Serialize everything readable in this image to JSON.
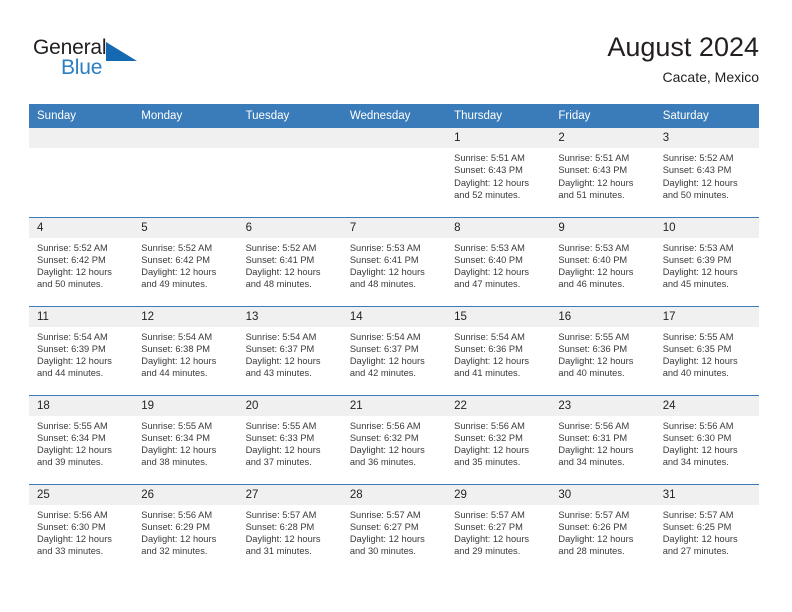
{
  "brand": {
    "name_top": "General",
    "name_bottom": "Blue",
    "flag_icon": "triangle-flag-icon",
    "accent_color": "#2b7fc3",
    "flag_color": "#1569b0"
  },
  "header": {
    "title": "August 2024",
    "subtitle": "Cacate, Mexico"
  },
  "calendar": {
    "header_bg": "#3a7cba",
    "daynum_bg": "#f0f0f0",
    "weekdays": [
      "Sunday",
      "Monday",
      "Tuesday",
      "Wednesday",
      "Thursday",
      "Friday",
      "Saturday"
    ],
    "weeks": [
      [
        {
          "day": "",
          "sunrise": "",
          "sunset": "",
          "daylight_line1": "",
          "daylight_line2": ""
        },
        {
          "day": "",
          "sunrise": "",
          "sunset": "",
          "daylight_line1": "",
          "daylight_line2": ""
        },
        {
          "day": "",
          "sunrise": "",
          "sunset": "",
          "daylight_line1": "",
          "daylight_line2": ""
        },
        {
          "day": "",
          "sunrise": "",
          "sunset": "",
          "daylight_line1": "",
          "daylight_line2": ""
        },
        {
          "day": "1",
          "sunrise": "Sunrise: 5:51 AM",
          "sunset": "Sunset: 6:43 PM",
          "daylight_line1": "Daylight: 12 hours",
          "daylight_line2": "and 52 minutes."
        },
        {
          "day": "2",
          "sunrise": "Sunrise: 5:51 AM",
          "sunset": "Sunset: 6:43 PM",
          "daylight_line1": "Daylight: 12 hours",
          "daylight_line2": "and 51 minutes."
        },
        {
          "day": "3",
          "sunrise": "Sunrise: 5:52 AM",
          "sunset": "Sunset: 6:43 PM",
          "daylight_line1": "Daylight: 12 hours",
          "daylight_line2": "and 50 minutes."
        }
      ],
      [
        {
          "day": "4",
          "sunrise": "Sunrise: 5:52 AM",
          "sunset": "Sunset: 6:42 PM",
          "daylight_line1": "Daylight: 12 hours",
          "daylight_line2": "and 50 minutes."
        },
        {
          "day": "5",
          "sunrise": "Sunrise: 5:52 AM",
          "sunset": "Sunset: 6:42 PM",
          "daylight_line1": "Daylight: 12 hours",
          "daylight_line2": "and 49 minutes."
        },
        {
          "day": "6",
          "sunrise": "Sunrise: 5:52 AM",
          "sunset": "Sunset: 6:41 PM",
          "daylight_line1": "Daylight: 12 hours",
          "daylight_line2": "and 48 minutes."
        },
        {
          "day": "7",
          "sunrise": "Sunrise: 5:53 AM",
          "sunset": "Sunset: 6:41 PM",
          "daylight_line1": "Daylight: 12 hours",
          "daylight_line2": "and 48 minutes."
        },
        {
          "day": "8",
          "sunrise": "Sunrise: 5:53 AM",
          "sunset": "Sunset: 6:40 PM",
          "daylight_line1": "Daylight: 12 hours",
          "daylight_line2": "and 47 minutes."
        },
        {
          "day": "9",
          "sunrise": "Sunrise: 5:53 AM",
          "sunset": "Sunset: 6:40 PM",
          "daylight_line1": "Daylight: 12 hours",
          "daylight_line2": "and 46 minutes."
        },
        {
          "day": "10",
          "sunrise": "Sunrise: 5:53 AM",
          "sunset": "Sunset: 6:39 PM",
          "daylight_line1": "Daylight: 12 hours",
          "daylight_line2": "and 45 minutes."
        }
      ],
      [
        {
          "day": "11",
          "sunrise": "Sunrise: 5:54 AM",
          "sunset": "Sunset: 6:39 PM",
          "daylight_line1": "Daylight: 12 hours",
          "daylight_line2": "and 44 minutes."
        },
        {
          "day": "12",
          "sunrise": "Sunrise: 5:54 AM",
          "sunset": "Sunset: 6:38 PM",
          "daylight_line1": "Daylight: 12 hours",
          "daylight_line2": "and 44 minutes."
        },
        {
          "day": "13",
          "sunrise": "Sunrise: 5:54 AM",
          "sunset": "Sunset: 6:37 PM",
          "daylight_line1": "Daylight: 12 hours",
          "daylight_line2": "and 43 minutes."
        },
        {
          "day": "14",
          "sunrise": "Sunrise: 5:54 AM",
          "sunset": "Sunset: 6:37 PM",
          "daylight_line1": "Daylight: 12 hours",
          "daylight_line2": "and 42 minutes."
        },
        {
          "day": "15",
          "sunrise": "Sunrise: 5:54 AM",
          "sunset": "Sunset: 6:36 PM",
          "daylight_line1": "Daylight: 12 hours",
          "daylight_line2": "and 41 minutes."
        },
        {
          "day": "16",
          "sunrise": "Sunrise: 5:55 AM",
          "sunset": "Sunset: 6:36 PM",
          "daylight_line1": "Daylight: 12 hours",
          "daylight_line2": "and 40 minutes."
        },
        {
          "day": "17",
          "sunrise": "Sunrise: 5:55 AM",
          "sunset": "Sunset: 6:35 PM",
          "daylight_line1": "Daylight: 12 hours",
          "daylight_line2": "and 40 minutes."
        }
      ],
      [
        {
          "day": "18",
          "sunrise": "Sunrise: 5:55 AM",
          "sunset": "Sunset: 6:34 PM",
          "daylight_line1": "Daylight: 12 hours",
          "daylight_line2": "and 39 minutes."
        },
        {
          "day": "19",
          "sunrise": "Sunrise: 5:55 AM",
          "sunset": "Sunset: 6:34 PM",
          "daylight_line1": "Daylight: 12 hours",
          "daylight_line2": "and 38 minutes."
        },
        {
          "day": "20",
          "sunrise": "Sunrise: 5:55 AM",
          "sunset": "Sunset: 6:33 PM",
          "daylight_line1": "Daylight: 12 hours",
          "daylight_line2": "and 37 minutes."
        },
        {
          "day": "21",
          "sunrise": "Sunrise: 5:56 AM",
          "sunset": "Sunset: 6:32 PM",
          "daylight_line1": "Daylight: 12 hours",
          "daylight_line2": "and 36 minutes."
        },
        {
          "day": "22",
          "sunrise": "Sunrise: 5:56 AM",
          "sunset": "Sunset: 6:32 PM",
          "daylight_line1": "Daylight: 12 hours",
          "daylight_line2": "and 35 minutes."
        },
        {
          "day": "23",
          "sunrise": "Sunrise: 5:56 AM",
          "sunset": "Sunset: 6:31 PM",
          "daylight_line1": "Daylight: 12 hours",
          "daylight_line2": "and 34 minutes."
        },
        {
          "day": "24",
          "sunrise": "Sunrise: 5:56 AM",
          "sunset": "Sunset: 6:30 PM",
          "daylight_line1": "Daylight: 12 hours",
          "daylight_line2": "and 34 minutes."
        }
      ],
      [
        {
          "day": "25",
          "sunrise": "Sunrise: 5:56 AM",
          "sunset": "Sunset: 6:30 PM",
          "daylight_line1": "Daylight: 12 hours",
          "daylight_line2": "and 33 minutes."
        },
        {
          "day": "26",
          "sunrise": "Sunrise: 5:56 AM",
          "sunset": "Sunset: 6:29 PM",
          "daylight_line1": "Daylight: 12 hours",
          "daylight_line2": "and 32 minutes."
        },
        {
          "day": "27",
          "sunrise": "Sunrise: 5:57 AM",
          "sunset": "Sunset: 6:28 PM",
          "daylight_line1": "Daylight: 12 hours",
          "daylight_line2": "and 31 minutes."
        },
        {
          "day": "28",
          "sunrise": "Sunrise: 5:57 AM",
          "sunset": "Sunset: 6:27 PM",
          "daylight_line1": "Daylight: 12 hours",
          "daylight_line2": "and 30 minutes."
        },
        {
          "day": "29",
          "sunrise": "Sunrise: 5:57 AM",
          "sunset": "Sunset: 6:27 PM",
          "daylight_line1": "Daylight: 12 hours",
          "daylight_line2": "and 29 minutes."
        },
        {
          "day": "30",
          "sunrise": "Sunrise: 5:57 AM",
          "sunset": "Sunset: 6:26 PM",
          "daylight_line1": "Daylight: 12 hours",
          "daylight_line2": "and 28 minutes."
        },
        {
          "day": "31",
          "sunrise": "Sunrise: 5:57 AM",
          "sunset": "Sunset: 6:25 PM",
          "daylight_line1": "Daylight: 12 hours",
          "daylight_line2": "and 27 minutes."
        }
      ]
    ]
  }
}
